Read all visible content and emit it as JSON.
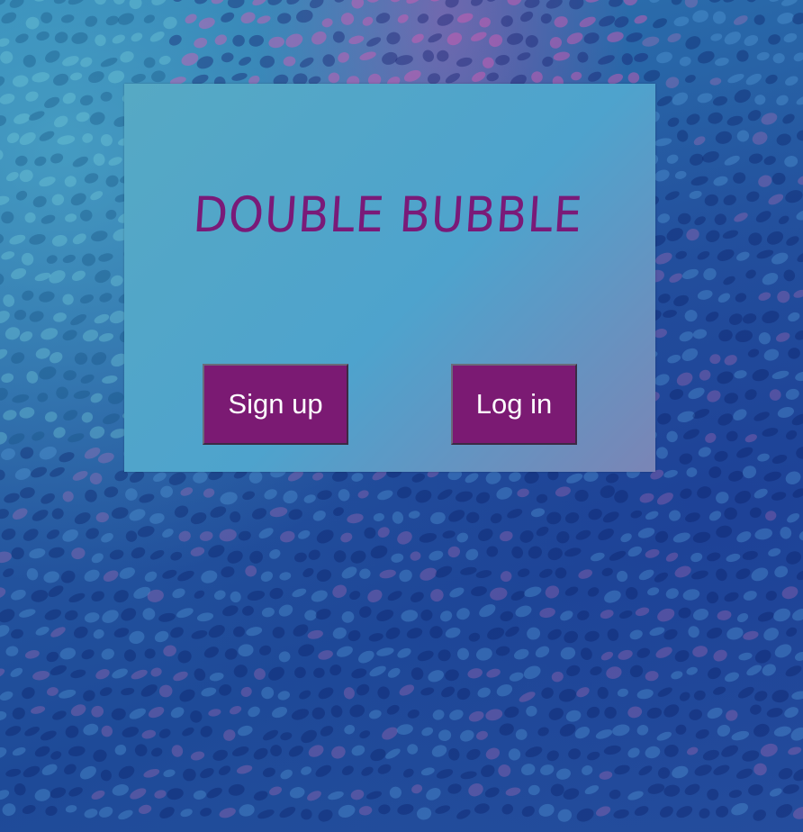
{
  "app": {
    "title": "DOUBLE BUBBLE"
  },
  "buttons": {
    "signup_label": "Sign up",
    "login_label": "Log in"
  },
  "colors": {
    "accent": "#7b1a73",
    "card_start": "#56a9c4",
    "card_end": "#7a85b6",
    "background": "#24559f"
  }
}
